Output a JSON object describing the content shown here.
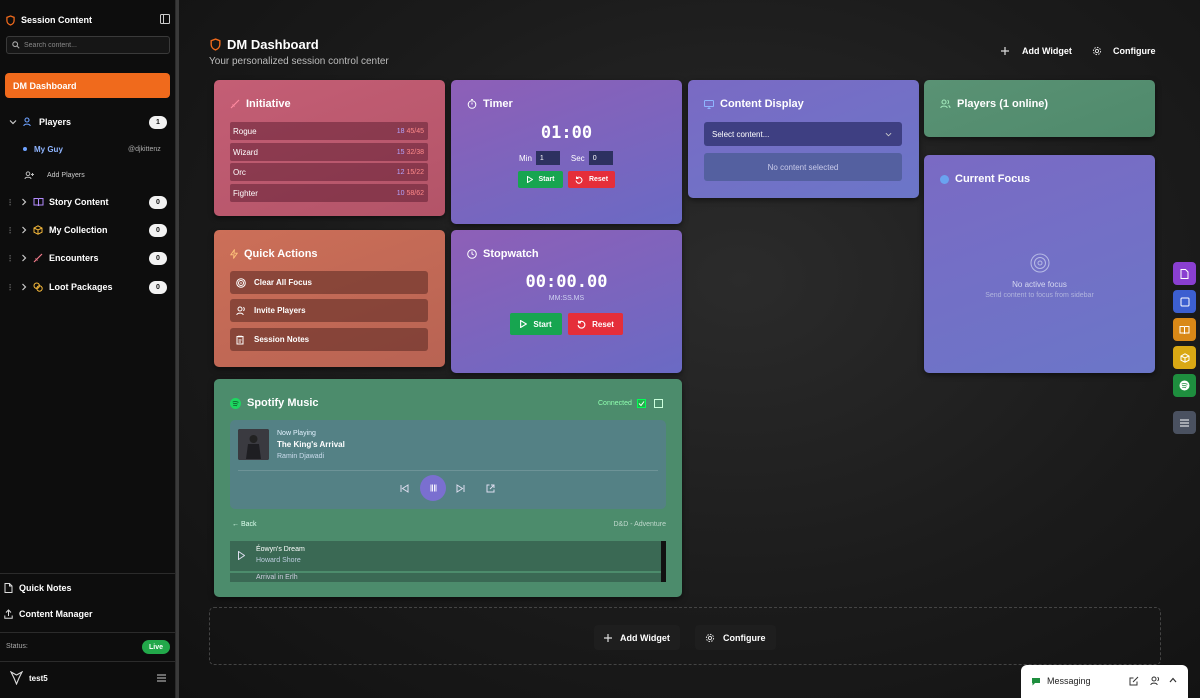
{
  "sidebar": {
    "title": "Session Content",
    "search_placeholder": "Search content...",
    "active_item": "DM Dashboard",
    "players": {
      "label": "Players",
      "count": "1",
      "player_name": "My Guy",
      "player_handle": "@djkittenz",
      "add_label": "Add Players"
    },
    "sections": [
      {
        "label": "Story Content",
        "count": "0"
      },
      {
        "label": "My Collection",
        "count": "0"
      },
      {
        "label": "Encounters",
        "count": "0"
      },
      {
        "label": "Loot Packages",
        "count": "0"
      }
    ],
    "quick_notes": "Quick Notes",
    "content_manager": "Content Manager",
    "status_label": "Status:",
    "status_value": "Live",
    "username": "test5"
  },
  "header": {
    "title": "DM Dashboard",
    "subtitle": "Your personalized session control center",
    "add_widget": "Add Widget",
    "configure": "Configure"
  },
  "initiative": {
    "title": "Initiative",
    "rows": [
      {
        "name": "Rogue",
        "init": "18",
        "hp": "45/45"
      },
      {
        "name": "Wizard",
        "init": "15",
        "hp": "32/38"
      },
      {
        "name": "Orc",
        "init": "12",
        "hp": "15/22"
      },
      {
        "name": "Fighter",
        "init": "10",
        "hp": "58/62"
      }
    ]
  },
  "timer": {
    "title": "Timer",
    "display": "01:00",
    "min_label": "Min",
    "min_value": "1",
    "sec_label": "Sec",
    "sec_value": "0",
    "start": "Start",
    "reset": "Reset"
  },
  "content_display": {
    "title": "Content Display",
    "select_value": "Select content...",
    "empty": "No content selected"
  },
  "players_widget": {
    "title": "Players (1 online)"
  },
  "current_focus": {
    "title": "Current Focus",
    "empty_title": "No active focus",
    "empty_hint": "Send content to focus from sidebar"
  },
  "quick_actions": {
    "title": "Quick Actions",
    "buttons": [
      "Clear All Focus",
      "Invite Players",
      "Session Notes"
    ]
  },
  "stopwatch": {
    "title": "Stopwatch",
    "display": "00:00.00",
    "format": "MM:SS.MS",
    "start": "Start",
    "reset": "Reset"
  },
  "spotify": {
    "title": "Spotify Music",
    "connected": "Connected",
    "now_playing_label": "Now Playing",
    "track": "The King's Arrival",
    "artist": "Ramin Djawadi",
    "back": "← Back",
    "playlist": "D&D - Adventure",
    "queue": [
      {
        "track": "Éowyn's Dream",
        "artist": "Howard Shore"
      },
      {
        "track": "Arrival in Erlh",
        "artist": ""
      }
    ]
  },
  "bottom_bar": {
    "add_widget": "Add Widget",
    "configure": "Configure"
  },
  "messaging": {
    "label": "Messaging"
  },
  "colors": {
    "accent": "#f06a1c",
    "live": "#22a84a",
    "start": "#17a550",
    "reset": "#e52e3a"
  }
}
